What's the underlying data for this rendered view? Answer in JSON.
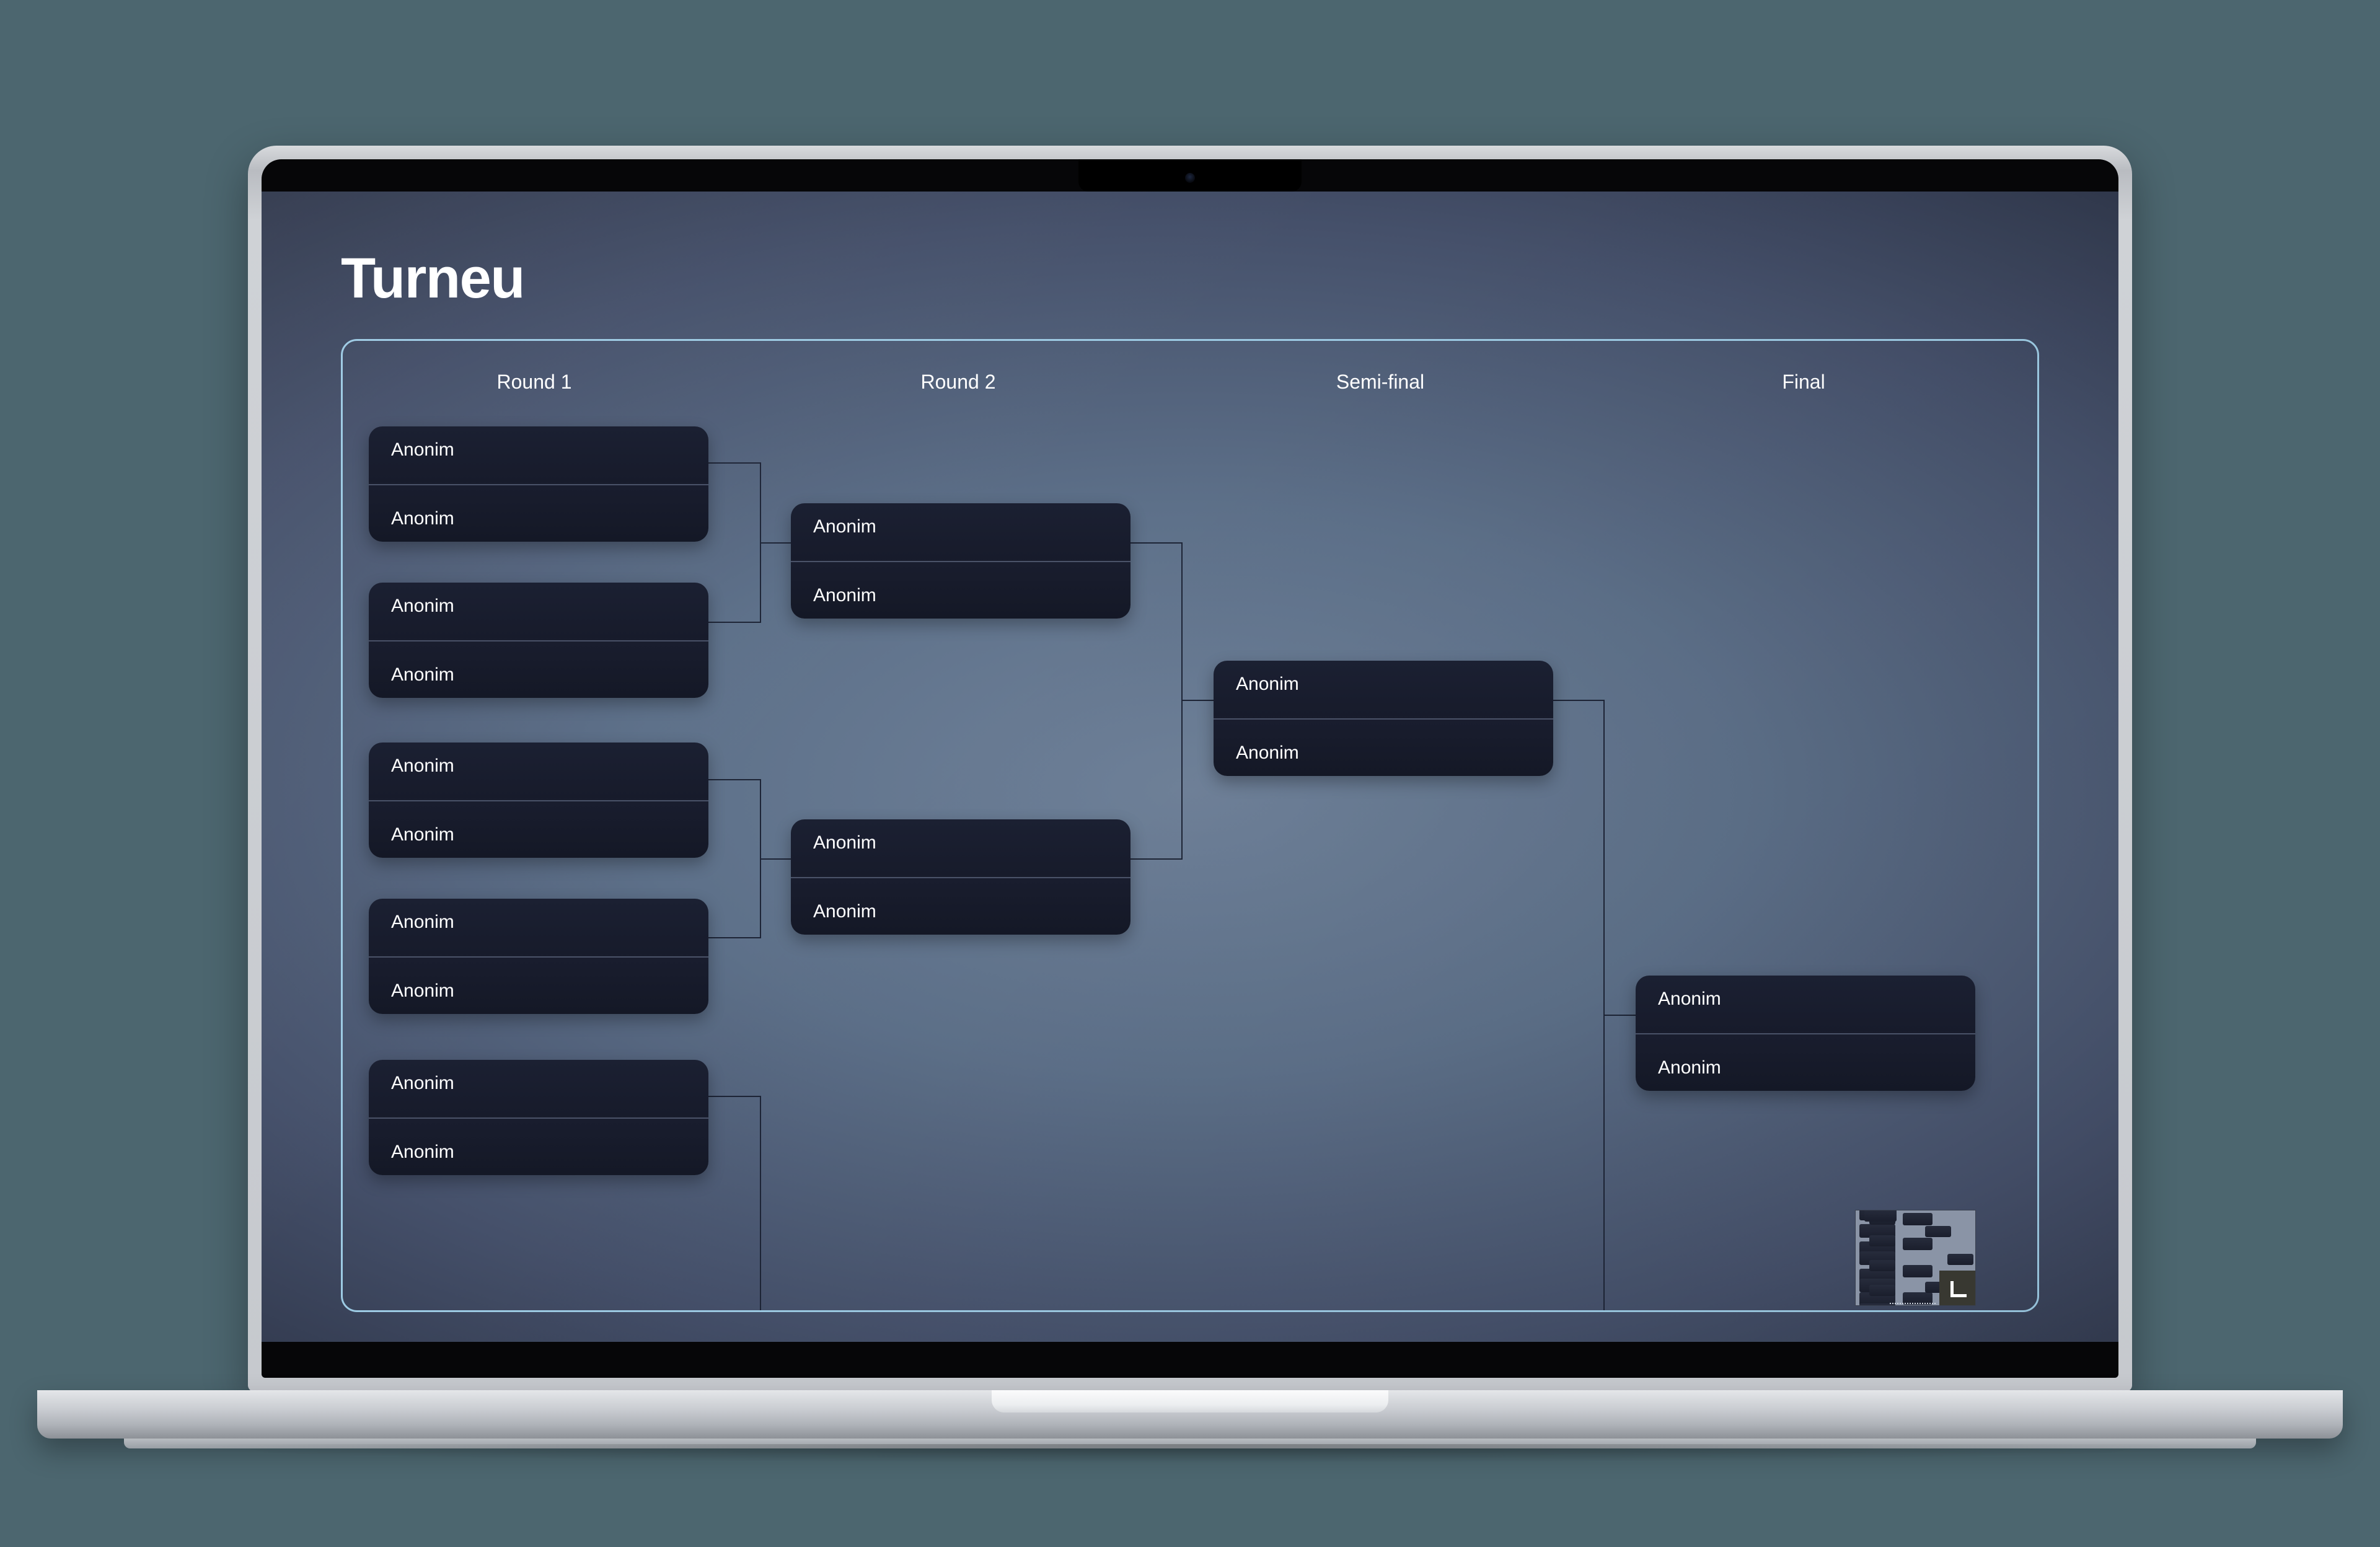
{
  "device": {
    "kind": "macbook",
    "notch_present": true,
    "camera_label": "camera"
  },
  "app": {
    "title": "Turneu",
    "background_start": "#6f8199",
    "background_end": "#232838",
    "accent_border": "#9dcbe4",
    "card_background": "#1b2032",
    "card_divider": "#4a5268",
    "text_color": "#ffffff",
    "connector_color": "#1d2436"
  },
  "bracket": {
    "rounds": [
      {
        "id": "round-1",
        "label": "Round 1"
      },
      {
        "id": "round-2",
        "label": "Round 2"
      },
      {
        "id": "semi-final",
        "label": "Semi-final"
      },
      {
        "id": "final",
        "label": "Final"
      }
    ],
    "matches": [
      {
        "round": "round-1",
        "index": 1,
        "players": [
          "Anonim",
          "Anonim"
        ]
      },
      {
        "round": "round-1",
        "index": 2,
        "players": [
          "Anonim",
          "Anonim"
        ]
      },
      {
        "round": "round-1",
        "index": 3,
        "players": [
          "Anonim",
          "Anonim"
        ]
      },
      {
        "round": "round-1",
        "index": 4,
        "players": [
          "Anonim",
          "Anonim"
        ]
      },
      {
        "round": "round-1",
        "index": 5,
        "players": [
          "Anonim",
          "Anonim"
        ]
      },
      {
        "round": "round-2",
        "index": 1,
        "players": [
          "Anonim",
          "Anonim"
        ]
      },
      {
        "round": "round-2",
        "index": 2,
        "players": [
          "Anonim",
          "Anonim"
        ]
      },
      {
        "round": "semi-final",
        "index": 1,
        "players": [
          "Anonim",
          "Anonim"
        ]
      },
      {
        "round": "final",
        "index": 1,
        "players": [
          "Anonim",
          "Anonim"
        ]
      }
    ]
  },
  "thumbnail": {
    "name": "bracket-preview",
    "resize_glyph": "⌐"
  }
}
